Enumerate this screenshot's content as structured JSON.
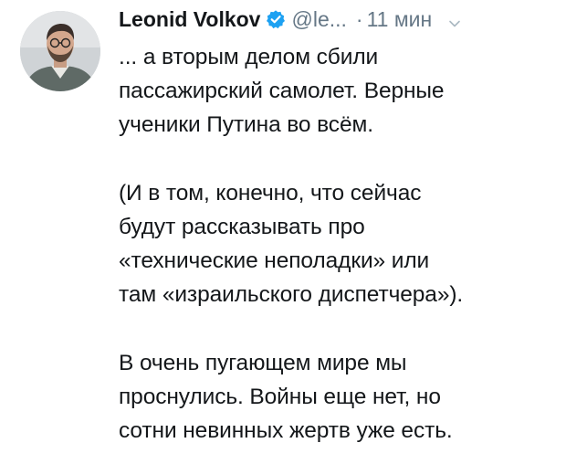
{
  "tweet": {
    "author_name": "Leonid Volkov",
    "handle": "@le...",
    "time": "11 мин",
    "separator": "·",
    "icons": {
      "verified": "verified-badge-icon",
      "more": "chevron-down-icon"
    },
    "accent_color": "#1da1f2",
    "paragraph1": [
      "... а вторым делом сбили",
      "пассажирский самолет. Верные",
      "ученики Путина во всём."
    ],
    "paragraph2": [
      "(И в том, конечно, что сейчас",
      "будут рассказывать про",
      "«технические неполадки» или",
      "там «израильского диспетчера»)."
    ],
    "paragraph3": [
      "В очень пугающем мире мы",
      "проснулись. Войны еще нет, но",
      "сотни невинных жертв уже есть."
    ]
  }
}
